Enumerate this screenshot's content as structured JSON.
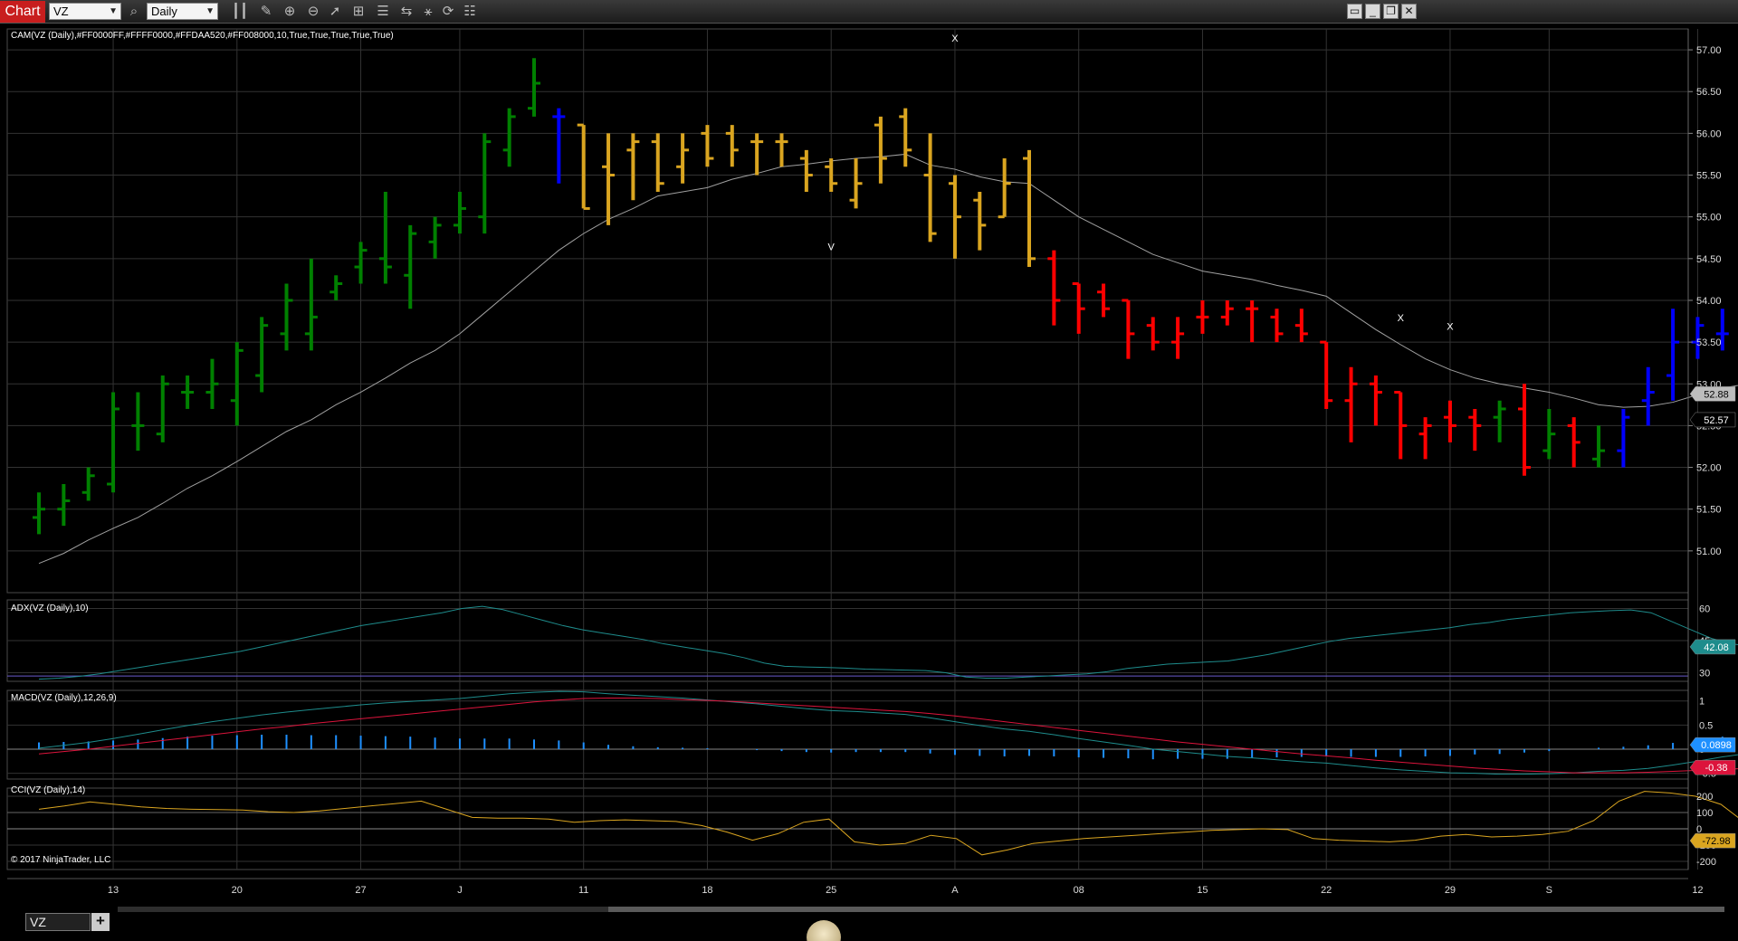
{
  "toolbar": {
    "tab_label": "Chart",
    "instrument": "VZ",
    "period": "Daily"
  },
  "indicators": {
    "cam_label": "CAM(VZ (Daily),#FF0000FF,#FFFF0000,#FFDAA520,#FF008000,10,True,True,True,True,True)",
    "adx_label": "ADX(VZ (Daily),10)",
    "macd_label": "MACD(VZ (Daily),12,26,9)",
    "cci_label": "CCI(VZ (Daily),14)"
  },
  "copyright": "© 2017 NinjaTrader, LLC",
  "bottom": {
    "symbol_tab": "VZ",
    "add_tab": "+"
  },
  "colors": {
    "background": "#000000",
    "up_trend": "#008000",
    "down_trend": "#FF0000",
    "neutral": "#DAA520",
    "reversal": "#0000FF",
    "current_up": "#32CD32",
    "sma_line": "#A0A0A0",
    "adx_line": "#1E8C8C",
    "macd_line": "#1E8C8C",
    "macd_avg": "#DC143C",
    "macd_hist": "#1E90FF",
    "cci_line": "#DAA520"
  },
  "chart_data": {
    "type": "ohlc",
    "x_labels": [
      "13",
      "20",
      "27",
      "J",
      "11",
      "18",
      "25",
      "A",
      "08",
      "15",
      "22",
      "29",
      "S",
      "12"
    ],
    "x_label_index": [
      3,
      8,
      13,
      17,
      22,
      27,
      32,
      37,
      42,
      47,
      52,
      57,
      61,
      67
    ],
    "price_axis": {
      "min": 50.5,
      "max": 57.25,
      "ticks": [
        "57.00",
        "56.50",
        "56.00",
        "55.50",
        "55.00",
        "54.50",
        "54.00",
        "53.50",
        "53.00",
        "52.50",
        "52.00",
        "51.50",
        "51.00"
      ]
    },
    "price_markers": [
      {
        "label": "52.88",
        "value": 52.88,
        "bg": "#bdbdbd",
        "fg": "#000000"
      },
      {
        "label": "52.57",
        "value": 52.57,
        "bg": "#000000",
        "fg": "#ffffff"
      }
    ],
    "bars": [
      {
        "o": 51.4,
        "h": 51.7,
        "l": 51.2,
        "c": 51.5,
        "s": "up"
      },
      {
        "o": 51.5,
        "h": 51.8,
        "l": 51.3,
        "c": 51.6,
        "s": "up"
      },
      {
        "o": 51.7,
        "h": 52.0,
        "l": 51.6,
        "c": 51.9,
        "s": "up"
      },
      {
        "o": 51.8,
        "h": 52.9,
        "l": 51.7,
        "c": 52.7,
        "s": "up"
      },
      {
        "o": 52.5,
        "h": 52.9,
        "l": 52.2,
        "c": 52.5,
        "s": "up"
      },
      {
        "o": 52.4,
        "h": 53.1,
        "l": 52.3,
        "c": 53.0,
        "s": "up"
      },
      {
        "o": 52.9,
        "h": 53.1,
        "l": 52.7,
        "c": 52.9,
        "s": "up"
      },
      {
        "o": 52.9,
        "h": 53.3,
        "l": 52.7,
        "c": 53.0,
        "s": "up"
      },
      {
        "o": 52.8,
        "h": 53.5,
        "l": 52.5,
        "c": 53.4,
        "s": "up"
      },
      {
        "o": 53.1,
        "h": 53.8,
        "l": 52.9,
        "c": 53.7,
        "s": "up"
      },
      {
        "o": 53.6,
        "h": 54.2,
        "l": 53.4,
        "c": 54.0,
        "s": "up"
      },
      {
        "o": 53.6,
        "h": 54.5,
        "l": 53.4,
        "c": 53.8,
        "s": "up"
      },
      {
        "o": 54.1,
        "h": 54.3,
        "l": 54.0,
        "c": 54.2,
        "s": "up"
      },
      {
        "o": 54.4,
        "h": 54.7,
        "l": 54.2,
        "c": 54.6,
        "s": "up"
      },
      {
        "o": 54.5,
        "h": 55.3,
        "l": 54.2,
        "c": 54.4,
        "s": "up"
      },
      {
        "o": 54.3,
        "h": 54.9,
        "l": 53.9,
        "c": 54.8,
        "s": "up"
      },
      {
        "o": 54.7,
        "h": 55.0,
        "l": 54.5,
        "c": 54.9,
        "s": "up"
      },
      {
        "o": 54.9,
        "h": 55.3,
        "l": 54.8,
        "c": 55.1,
        "s": "up"
      },
      {
        "o": 55.0,
        "h": 56.0,
        "l": 54.8,
        "c": 55.9,
        "s": "up"
      },
      {
        "o": 55.8,
        "h": 56.3,
        "l": 55.6,
        "c": 56.2,
        "s": "up"
      },
      {
        "o": 56.3,
        "h": 56.9,
        "l": 56.2,
        "c": 56.6,
        "s": "up"
      },
      {
        "o": 56.2,
        "h": 56.3,
        "l": 55.4,
        "c": 56.2,
        "s": "rev"
      },
      {
        "o": 56.1,
        "h": 56.1,
        "l": 55.1,
        "c": 55.1,
        "s": "neu"
      },
      {
        "o": 55.6,
        "h": 56.0,
        "l": 54.9,
        "c": 55.5,
        "s": "neu"
      },
      {
        "o": 55.8,
        "h": 56.0,
        "l": 55.2,
        "c": 55.9,
        "s": "neu"
      },
      {
        "o": 55.9,
        "h": 56.0,
        "l": 55.3,
        "c": 55.4,
        "s": "neu"
      },
      {
        "o": 55.6,
        "h": 56.0,
        "l": 55.4,
        "c": 55.8,
        "s": "neu"
      },
      {
        "o": 56.0,
        "h": 56.1,
        "l": 55.6,
        "c": 55.7,
        "s": "neu"
      },
      {
        "o": 56.0,
        "h": 56.1,
        "l": 55.6,
        "c": 55.8,
        "s": "neu"
      },
      {
        "o": 55.9,
        "h": 56.0,
        "l": 55.5,
        "c": 55.9,
        "s": "neu"
      },
      {
        "o": 55.9,
        "h": 56.0,
        "l": 55.6,
        "c": 55.9,
        "s": "neu"
      },
      {
        "o": 55.7,
        "h": 55.8,
        "l": 55.3,
        "c": 55.5,
        "s": "neu"
      },
      {
        "o": 55.6,
        "h": 55.7,
        "l": 55.3,
        "c": 55.4,
        "s": "neu"
      },
      {
        "o": 55.2,
        "h": 55.7,
        "l": 55.1,
        "c": 55.4,
        "s": "neu"
      },
      {
        "o": 56.1,
        "h": 56.2,
        "l": 55.4,
        "c": 55.7,
        "s": "neu"
      },
      {
        "o": 56.2,
        "h": 56.3,
        "l": 55.6,
        "c": 55.8,
        "s": "neu"
      },
      {
        "o": 55.5,
        "h": 56.0,
        "l": 54.7,
        "c": 54.8,
        "s": "neu"
      },
      {
        "o": 55.4,
        "h": 55.5,
        "l": 54.5,
        "c": 55.0,
        "s": "neu"
      },
      {
        "o": 55.2,
        "h": 55.3,
        "l": 54.6,
        "c": 54.9,
        "s": "neu"
      },
      {
        "o": 55.0,
        "h": 55.7,
        "l": 55.0,
        "c": 55.4,
        "s": "neu"
      },
      {
        "o": 55.7,
        "h": 55.8,
        "l": 54.4,
        "c": 54.5,
        "s": "neu"
      },
      {
        "o": 54.5,
        "h": 54.6,
        "l": 53.7,
        "c": 54.0,
        "s": "dn"
      },
      {
        "o": 54.2,
        "h": 54.2,
        "l": 53.6,
        "c": 53.9,
        "s": "dn"
      },
      {
        "o": 54.1,
        "h": 54.2,
        "l": 53.8,
        "c": 53.9,
        "s": "dn"
      },
      {
        "o": 54.0,
        "h": 54.0,
        "l": 53.3,
        "c": 53.6,
        "s": "dn"
      },
      {
        "o": 53.7,
        "h": 53.8,
        "l": 53.4,
        "c": 53.5,
        "s": "dn"
      },
      {
        "o": 53.5,
        "h": 53.8,
        "l": 53.3,
        "c": 53.6,
        "s": "dn"
      },
      {
        "o": 53.8,
        "h": 54.0,
        "l": 53.6,
        "c": 53.8,
        "s": "dn"
      },
      {
        "o": 53.8,
        "h": 54.0,
        "l": 53.7,
        "c": 53.9,
        "s": "dn"
      },
      {
        "o": 53.9,
        "h": 54.0,
        "l": 53.5,
        "c": 53.9,
        "s": "dn"
      },
      {
        "o": 53.8,
        "h": 53.9,
        "l": 53.5,
        "c": 53.6,
        "s": "dn"
      },
      {
        "o": 53.7,
        "h": 53.9,
        "l": 53.5,
        "c": 53.6,
        "s": "dn"
      },
      {
        "o": 53.5,
        "h": 53.5,
        "l": 52.7,
        "c": 52.8,
        "s": "dn"
      },
      {
        "o": 52.8,
        "h": 53.2,
        "l": 52.3,
        "c": 53.0,
        "s": "dn"
      },
      {
        "o": 53.0,
        "h": 53.1,
        "l": 52.5,
        "c": 52.9,
        "s": "dn"
      },
      {
        "o": 52.9,
        "h": 52.9,
        "l": 52.1,
        "c": 52.5,
        "s": "dn"
      },
      {
        "o": 52.4,
        "h": 52.6,
        "l": 52.1,
        "c": 52.5,
        "s": "dn"
      },
      {
        "o": 52.6,
        "h": 52.8,
        "l": 52.3,
        "c": 52.5,
        "s": "dn"
      },
      {
        "o": 52.6,
        "h": 52.7,
        "l": 52.2,
        "c": 52.5,
        "s": "dn"
      },
      {
        "o": 52.6,
        "h": 52.8,
        "l": 52.3,
        "c": 52.7,
        "s": "up"
      },
      {
        "o": 52.7,
        "h": 53.0,
        "l": 51.9,
        "c": 52.0,
        "s": "dn"
      },
      {
        "o": 52.2,
        "h": 52.7,
        "l": 52.1,
        "c": 52.4,
        "s": "up"
      },
      {
        "o": 52.5,
        "h": 52.6,
        "l": 52.0,
        "c": 52.3,
        "s": "dn"
      },
      {
        "o": 52.1,
        "h": 52.5,
        "l": 52.0,
        "c": 52.2,
        "s": "up"
      },
      {
        "o": 52.2,
        "h": 52.7,
        "l": 52.0,
        "c": 52.6,
        "s": "rev"
      },
      {
        "o": 52.8,
        "h": 53.2,
        "l": 52.5,
        "c": 52.9,
        "s": "rev"
      },
      {
        "o": 53.1,
        "h": 53.9,
        "l": 52.8,
        "c": 53.5,
        "s": "rev"
      },
      {
        "o": 53.5,
        "h": 53.8,
        "l": 53.3,
        "c": 53.7,
        "s": "rev"
      },
      {
        "o": 53.6,
        "h": 53.9,
        "l": 53.4,
        "c": 53.6,
        "s": "rev"
      },
      {
        "o": 53.1,
        "h": 53.3,
        "l": 51.8,
        "c": 51.9,
        "s": "neu"
      },
      {
        "o": 51.8,
        "h": 52.9,
        "l": 51.7,
        "c": 52.57,
        "s": "cur"
      }
    ],
    "sma": [
      50.85,
      50.97,
      51.13,
      51.27,
      51.4,
      51.57,
      51.75,
      51.9,
      52.07,
      52.25,
      52.43,
      52.57,
      52.75,
      52.9,
      53.07,
      53.25,
      53.4,
      53.6,
      53.85,
      54.1,
      54.35,
      54.6,
      54.8,
      54.97,
      55.1,
      55.25,
      55.3,
      55.35,
      55.45,
      55.52,
      55.6,
      55.63,
      55.67,
      55.7,
      55.72,
      55.75,
      55.62,
      55.57,
      55.48,
      55.42,
      55.4,
      55.2,
      55.0,
      54.85,
      54.7,
      54.55,
      54.45,
      54.35,
      54.3,
      54.25,
      54.18,
      54.12,
      54.05,
      53.85,
      53.65,
      53.47,
      53.3,
      53.17,
      53.07,
      53.0,
      52.95,
      52.9,
      52.83,
      52.75,
      52.72,
      52.73,
      52.78,
      52.87,
      52.95,
      53.0,
      52.88,
      52.88
    ],
    "markers": [
      {
        "text": "X",
        "index": 37,
        "price": 57.1
      },
      {
        "text": "V",
        "index": 32,
        "price": 54.6
      },
      {
        "text": "X",
        "index": 55,
        "price": 53.75
      },
      {
        "text": "X",
        "index": 57,
        "price": 53.65
      }
    ],
    "adx": {
      "axis": {
        "min": 26,
        "max": 64,
        "ticks": [
          "60",
          "45",
          "30"
        ]
      },
      "marker": {
        "label": "42.08",
        "value": 42.08,
        "bg": "#1e8c8c",
        "fg": "#ffffff"
      },
      "values": [
        27,
        27.5,
        28.3,
        29.5,
        31,
        32.5,
        34,
        35.5,
        37,
        38.5,
        40,
        42,
        44,
        46,
        48,
        50,
        52,
        53.5,
        55,
        56.5,
        58,
        60,
        61,
        59.5,
        57,
        54.5,
        52,
        50,
        48.5,
        47,
        45.5,
        43.5,
        42,
        40.5,
        39,
        37,
        34.5,
        33,
        32.7,
        32.5,
        32.2,
        31.7,
        31.5,
        31.2,
        31,
        30,
        28,
        27.5,
        27.5,
        28,
        28.5,
        29,
        29.5,
        30.5,
        32,
        33,
        34,
        34.5,
        35,
        35.5,
        37,
        38.5,
        40.5,
        42.5,
        44.5,
        46,
        47,
        48,
        49,
        50,
        51,
        52.5,
        53.5,
        55,
        56,
        57,
        58,
        58.5,
        59,
        59.3,
        58,
        54,
        50,
        46,
        43.5,
        42.2,
        42.08
      ]
    },
    "macd": {
      "axis": {
        "min": -0.62,
        "max": 1.22,
        "ticks": [
          "1",
          "0.5",
          "0",
          "-0.5"
        ]
      },
      "markers": [
        {
          "label": "0.0898",
          "value": 0.0898,
          "bg": "#1e90ff",
          "fg": "#ffffff"
        },
        {
          "label": "-0.38",
          "value": -0.38,
          "bg": "#dc143c",
          "fg": "#ffffff"
        }
      ],
      "macd": [
        0.02,
        0.08,
        0.14,
        0.22,
        0.31,
        0.4,
        0.49,
        0.57,
        0.64,
        0.71,
        0.77,
        0.82,
        0.87,
        0.92,
        0.96,
        0.99,
        1.02,
        1.05,
        1.1,
        1.15,
        1.18,
        1.2,
        1.19,
        1.15,
        1.12,
        1.09,
        1.06,
        1.02,
        0.98,
        0.94,
        0.89,
        0.84,
        0.8,
        0.78,
        0.75,
        0.72,
        0.65,
        0.57,
        0.49,
        0.42,
        0.37,
        0.3,
        0.22,
        0.15,
        0.08,
        0.0,
        -0.05,
        -0.1,
        -0.15,
        -0.18,
        -0.22,
        -0.26,
        -0.29,
        -0.34,
        -0.39,
        -0.43,
        -0.46,
        -0.49,
        -0.5,
        -0.52,
        -0.52,
        -0.51,
        -0.49,
        -0.46,
        -0.44,
        -0.4,
        -0.33,
        -0.25,
        -0.16,
        -0.09,
        -0.05,
        -0.29
      ],
      "signal": [
        -0.1,
        -0.05,
        0.0,
        0.06,
        0.12,
        0.18,
        0.24,
        0.3,
        0.36,
        0.42,
        0.47,
        0.53,
        0.58,
        0.63,
        0.68,
        0.73,
        0.78,
        0.83,
        0.88,
        0.93,
        0.98,
        1.02,
        1.05,
        1.06,
        1.06,
        1.05,
        1.03,
        1.01,
        0.99,
        0.96,
        0.93,
        0.9,
        0.87,
        0.84,
        0.81,
        0.78,
        0.74,
        0.69,
        0.63,
        0.57,
        0.51,
        0.45,
        0.39,
        0.33,
        0.27,
        0.21,
        0.15,
        0.1,
        0.05,
        0.0,
        -0.05,
        -0.1,
        -0.14,
        -0.18,
        -0.23,
        -0.27,
        -0.31,
        -0.35,
        -0.39,
        -0.42,
        -0.45,
        -0.47,
        -0.49,
        -0.49,
        -0.49,
        -0.48,
        -0.46,
        -0.44,
        -0.42,
        -0.4,
        -0.39,
        -0.38
      ],
      "histogram": [
        0.14,
        0.15,
        0.16,
        0.18,
        0.2,
        0.23,
        0.26,
        0.28,
        0.29,
        0.3,
        0.3,
        0.29,
        0.29,
        0.28,
        0.27,
        0.26,
        0.24,
        0.22,
        0.22,
        0.22,
        0.2,
        0.18,
        0.14,
        0.09,
        0.06,
        0.04,
        0.03,
        0.02,
        0.0,
        -0.02,
        -0.04,
        -0.06,
        -0.07,
        -0.06,
        -0.06,
        -0.06,
        -0.09,
        -0.12,
        -0.14,
        -0.15,
        -0.14,
        -0.15,
        -0.17,
        -0.18,
        -0.19,
        -0.21,
        -0.2,
        -0.2,
        -0.2,
        -0.18,
        -0.17,
        -0.16,
        -0.15,
        -0.16,
        -0.16,
        -0.16,
        -0.15,
        -0.14,
        -0.11,
        -0.1,
        -0.07,
        -0.04,
        0.0,
        0.03,
        0.05,
        0.08,
        0.13,
        0.19,
        0.26,
        0.31,
        0.34,
        0.09
      ]
    },
    "cci": {
      "axis": {
        "min": -250,
        "max": 250,
        "ticks": [
          "200",
          "100",
          "0",
          "-100",
          "-200"
        ]
      },
      "marker": {
        "label": "-72.98",
        "value": -72.98,
        "bg": "#daa520",
        "fg": "#000000"
      },
      "values": [
        120,
        140,
        165,
        150,
        135,
        125,
        120,
        118,
        115,
        105,
        100,
        110,
        125,
        140,
        155,
        170,
        120,
        70,
        65,
        65,
        60,
        40,
        50,
        55,
        50,
        45,
        20,
        -20,
        -70,
        -30,
        40,
        60,
        -80,
        -100,
        -90,
        -40,
        -60,
        -160,
        -130,
        -90,
        -75,
        -60,
        -50,
        -40,
        -30,
        -20,
        -10,
        -5,
        0,
        -5,
        -60,
        -70,
        -75,
        -80,
        -70,
        -45,
        -35,
        -50,
        -45,
        -35,
        -15,
        50,
        170,
        230,
        220,
        200,
        150,
        30,
        -72.98
      ]
    },
    "x_axis_label_type": "date"
  }
}
